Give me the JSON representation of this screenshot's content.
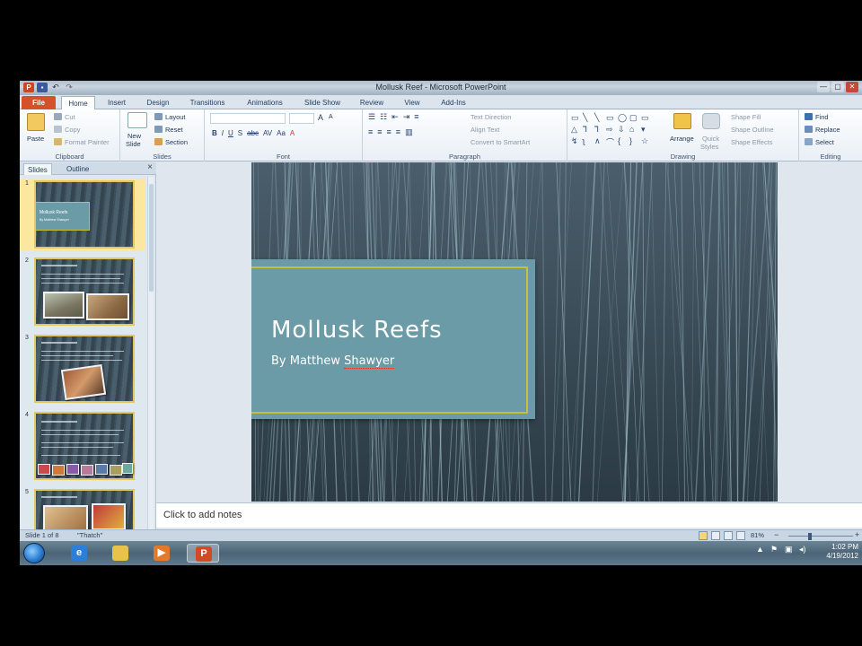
{
  "window": {
    "title": "Mollusk Reef - Microsoft PowerPoint",
    "app_glyph": "P",
    "minimize": "—",
    "maximize": "▢",
    "close": "✕"
  },
  "tabs": [
    {
      "label": "File"
    },
    {
      "label": "Home"
    },
    {
      "label": "Insert"
    },
    {
      "label": "Design"
    },
    {
      "label": "Transitions"
    },
    {
      "label": "Animations"
    },
    {
      "label": "Slide Show"
    },
    {
      "label": "Review"
    },
    {
      "label": "View"
    },
    {
      "label": "Add-Ins"
    }
  ],
  "ribbon": {
    "clipboard": {
      "label": "Clipboard",
      "paste": "Paste",
      "cut": "Cut",
      "copy": "Copy",
      "format_painter": "Format Painter"
    },
    "slides": {
      "label": "Slides",
      "new_slide": "New",
      "new_slide_2": "Slide",
      "layout": "Layout",
      "reset": "Reset",
      "section": "Section"
    },
    "font": {
      "label": "Font",
      "bold": "B",
      "italic": "I",
      "underline": "U",
      "strike": "S",
      "abc": "abc",
      "spacing": "AV",
      "case": "Aa",
      "color": "A",
      "grow": "A",
      "shrink": "A"
    },
    "paragraph": {
      "label": "Paragraph",
      "text_direction": "Text Direction",
      "align_text": "Align Text",
      "convert_smartart": "Convert to SmartArt"
    },
    "drawing": {
      "label": "Drawing",
      "arrange": "Arrange",
      "quick_styles": "Quick",
      "quick_styles_2": "Styles",
      "shape_fill": "Shape Fill",
      "shape_outline": "Shape Outline",
      "shape_effects": "Shape Effects"
    },
    "editing": {
      "label": "Editing",
      "find": "Find",
      "replace": "Replace",
      "select": "Select"
    }
  },
  "left_pane": {
    "tabs": [
      {
        "label": "Slides"
      },
      {
        "label": "Outline"
      }
    ],
    "close": "×",
    "thumbnails": [
      {
        "number": "1",
        "title": "Mollusk Reefs",
        "subtitle": "By Matthew Shawyer"
      },
      {
        "number": "2"
      },
      {
        "number": "3"
      },
      {
        "number": "4"
      },
      {
        "number": "5"
      }
    ]
  },
  "slide": {
    "title": "Mollusk Reefs",
    "subtitle_prefix": "By Matthew ",
    "subtitle_misspelled": "Shawyer"
  },
  "notes": {
    "placeholder": "Click to add notes"
  },
  "status": {
    "slide_counter": "Slide 1 of 8",
    "theme": "\"Thatch\"",
    "zoom": "81%",
    "zoom_minus": "−",
    "zoom_plus": "+"
  },
  "taskbar": {
    "clock_time": "1:02 PM",
    "clock_date": "4/19/2012",
    "powerpoint_glyph": "P"
  }
}
